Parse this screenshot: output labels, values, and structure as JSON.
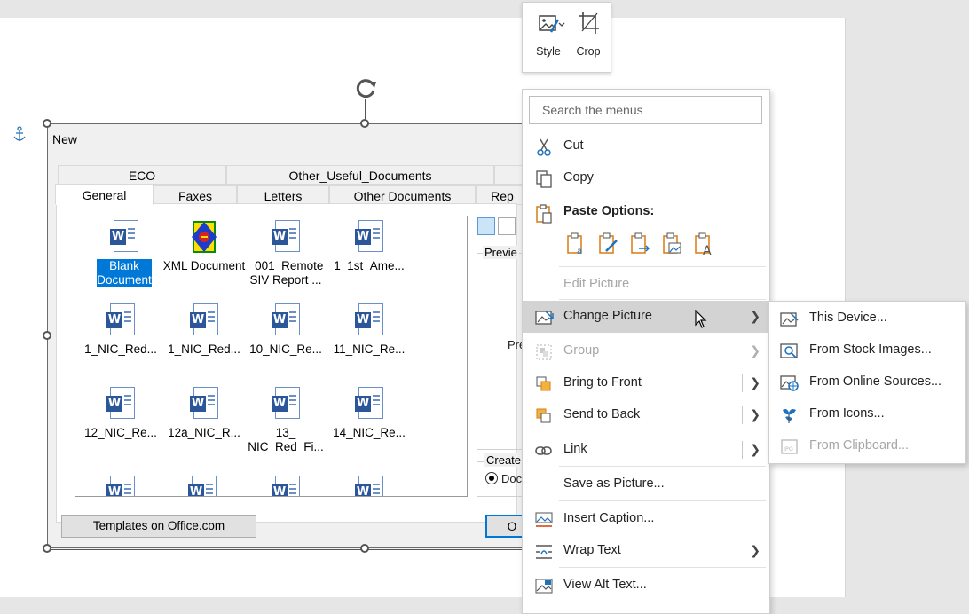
{
  "floater": {
    "style_label": "Style",
    "crop_label": "Crop"
  },
  "dialog": {
    "title": "New",
    "tabs_row1": [
      "ECO",
      "Other_Useful_Documents"
    ],
    "tabs_row2": [
      "General",
      "Faxes",
      "Letters",
      "Other Documents",
      "Rep"
    ],
    "files": [
      {
        "label": "Blank Document",
        "icon": "word-doc-icon",
        "selected": true
      },
      {
        "label": "XML Document",
        "icon": "xml-doc-icon"
      },
      {
        "label": "_001_Remote SIV Report ...",
        "icon": "word-doc-icon"
      },
      {
        "label": "1_1st_Ame...",
        "icon": "word-doc-icon"
      },
      {
        "label": "1_NIC_Red...",
        "icon": "word-doc-icon"
      },
      {
        "label": "1_NIC_Red...",
        "icon": "word-doc-icon"
      },
      {
        "label": "10_NIC_Re...",
        "icon": "word-doc-icon"
      },
      {
        "label": "11_NIC_Re...",
        "icon": "word-doc-icon"
      },
      {
        "label": "12_NIC_Re...",
        "icon": "word-doc-icon"
      },
      {
        "label": "12a_NIC_R...",
        "icon": "word-doc-icon"
      },
      {
        "label": "13_ NIC_Red_Fi...",
        "icon": "word-doc-icon"
      },
      {
        "label": "14_NIC_Re...",
        "icon": "word-doc-icon"
      }
    ],
    "preview_label": "Previe",
    "preview_text": "Pre",
    "create_label": "Create",
    "radio_label": "Doc",
    "templates_button": "Templates on Office.com",
    "ok_button": "O"
  },
  "context_menu": {
    "search_placeholder": "Search the menus",
    "cut": "Cut",
    "copy": "Copy",
    "paste_options": "Paste Options:",
    "edit_picture": "Edit Picture",
    "change_picture": "Change Picture",
    "group": "Group",
    "bring_to_front": "Bring to Front",
    "send_to_back": "Send to Back",
    "link": "Link",
    "save_as_picture": "Save as Picture...",
    "insert_caption": "Insert Caption...",
    "wrap_text": "Wrap Text",
    "view_alt_text": "View Alt Text..."
  },
  "submenu": {
    "this_device": "This Device...",
    "stock_images": "From Stock Images...",
    "online_sources": "From Online Sources...",
    "icons": "From Icons...",
    "clipboard": "From Clipboard..."
  },
  "colors": {
    "accent": "#0078d7",
    "orange": "#d97b12",
    "word_blue": "#2b579a"
  }
}
